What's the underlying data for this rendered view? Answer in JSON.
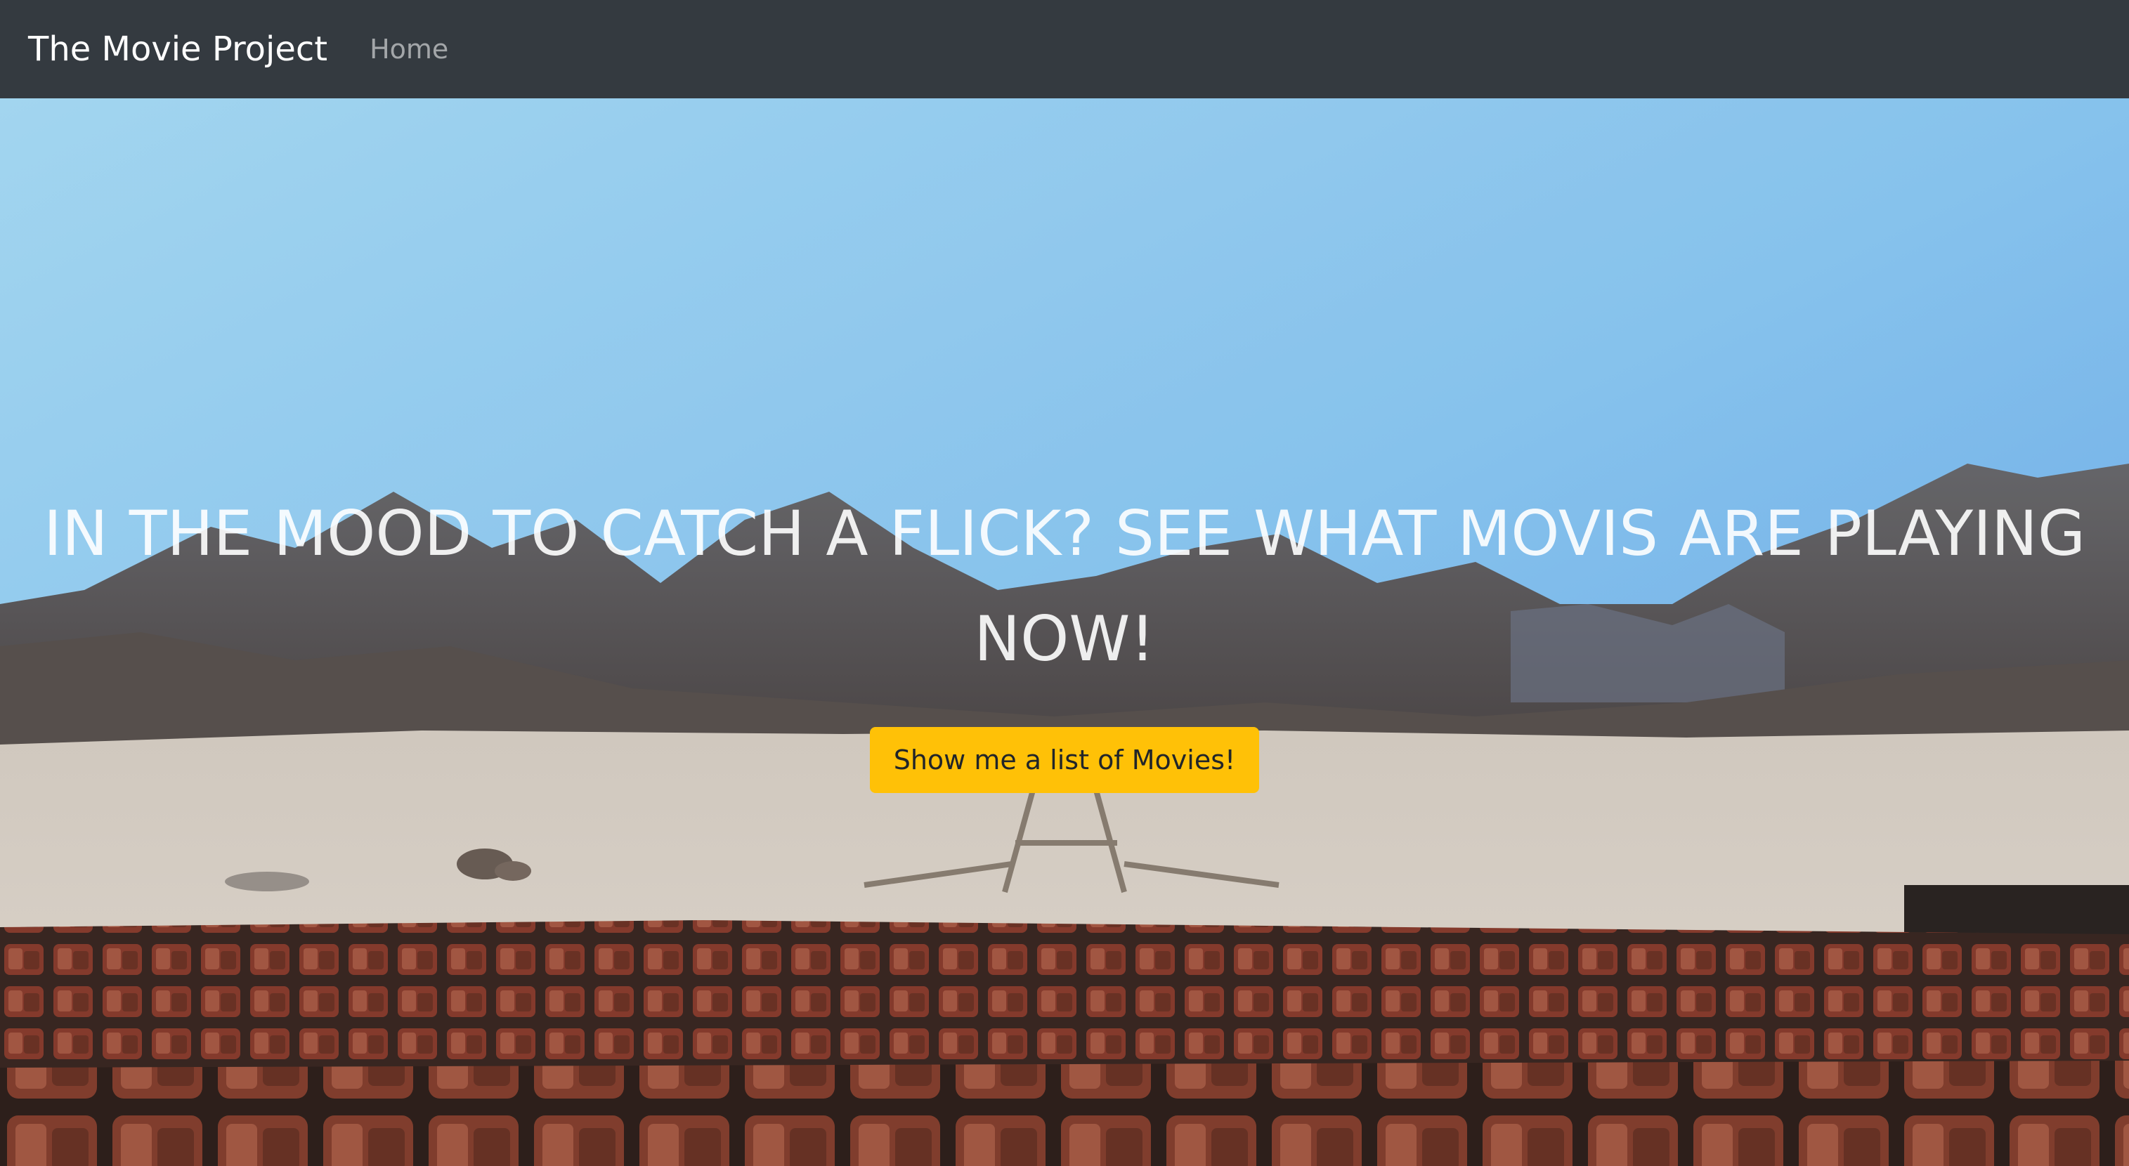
{
  "navbar": {
    "brand": "The Movie Project",
    "links": [
      {
        "label": "Home"
      }
    ]
  },
  "hero": {
    "headline": "IN THE MOOD TO CATCH A FLICK? SEE WHAT MOVIS ARE PLAYING NOW!",
    "button_label": "Show me a list of Movies!",
    "background": "photo of an abandoned outdoor cinema with rows of rusty red seats in a desert below mountains under a blue sky"
  },
  "colors": {
    "navbar_bg": "#343a40",
    "button_bg": "#ffc107",
    "button_text": "#212529",
    "headline_text": "#ffffff"
  }
}
